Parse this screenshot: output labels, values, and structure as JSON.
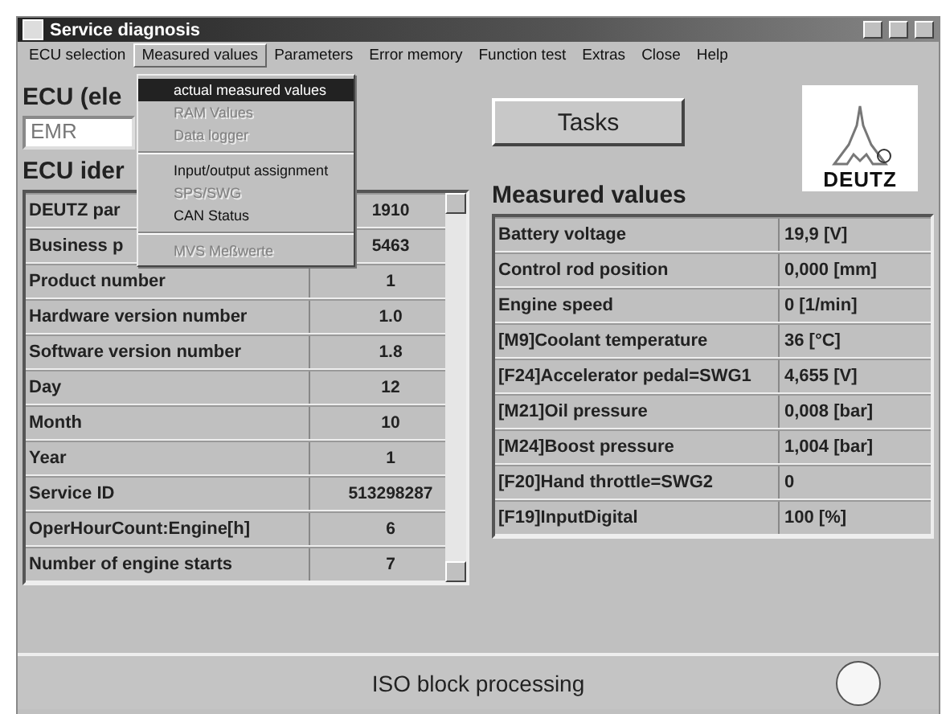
{
  "window": {
    "title": "Service diagnosis"
  },
  "menu_bar": [
    {
      "label": "ECU selection",
      "selected": false
    },
    {
      "label": "Measured values",
      "selected": true
    },
    {
      "label": "Parameters",
      "selected": false
    },
    {
      "label": "Error memory",
      "selected": false
    },
    {
      "label": "Function test",
      "selected": false
    },
    {
      "label": "Extras",
      "selected": false
    },
    {
      "label": "Close",
      "selected": false
    },
    {
      "label": "Help",
      "selected": false
    }
  ],
  "dropdown": [
    {
      "kind": "item",
      "label": "actual measured values",
      "selected": true,
      "disabled": false
    },
    {
      "kind": "item",
      "label": "RAM Values",
      "selected": false,
      "disabled": true
    },
    {
      "kind": "item",
      "label": "Data logger",
      "selected": false,
      "disabled": true
    },
    {
      "kind": "separator"
    },
    {
      "kind": "item",
      "label": "Input/output assignment",
      "selected": false,
      "disabled": false
    },
    {
      "kind": "item",
      "label": "SPS/SWG",
      "selected": false,
      "disabled": true
    },
    {
      "kind": "item",
      "label": "CAN Status",
      "selected": false,
      "disabled": false
    },
    {
      "kind": "separator"
    },
    {
      "kind": "item",
      "label": "MVS Meßwerte",
      "selected": false,
      "disabled": true
    }
  ],
  "ecu_label": "ECU (ele",
  "ecu_field": {
    "value": "EMR"
  },
  "tasks_button": "Tasks",
  "logo": "DEUTZ",
  "ecu_identification": {
    "label": "ECU ider",
    "rows": [
      {
        "name": "DEUTZ par",
        "value": "1910"
      },
      {
        "name": "Business p",
        "value": "5463"
      },
      {
        "name": "Product number",
        "value": "1"
      },
      {
        "name": "Hardware version number",
        "value": "1.0"
      },
      {
        "name": "Software version number",
        "value": "1.8"
      },
      {
        "name": "Day",
        "value": "12"
      },
      {
        "name": "Month",
        "value": "10"
      },
      {
        "name": "Year",
        "value": "1"
      },
      {
        "name": "Service ID",
        "value": "513298287"
      },
      {
        "name": "OperHourCount:Engine[h]",
        "value": "6"
      },
      {
        "name": "Number of engine starts",
        "value": "7"
      }
    ]
  },
  "measured_values": {
    "label": "Measured values",
    "rows": [
      {
        "name": "Battery voltage",
        "value": "19,9 [V]"
      },
      {
        "name": "Control rod position",
        "value": "0,000 [mm]"
      },
      {
        "name": "Engine speed",
        "value": "0 [1/min]"
      },
      {
        "name": "[M9]Coolant temperature",
        "value": "36 [°C]"
      },
      {
        "name": "[F24]Accelerator pedal=SWG1",
        "value": "4,655 [V]"
      },
      {
        "name": "[M21]Oil pressure",
        "value": "0,008 [bar]"
      },
      {
        "name": "[M24]Boost pressure",
        "value": "1,004 [bar]"
      },
      {
        "name": "[F20]Hand throttle=SWG2",
        "value": "0"
      },
      {
        "name": "[F19]InputDigital",
        "value": "100 [%]"
      }
    ]
  },
  "status_bar": {
    "text": "ISO block processing"
  }
}
